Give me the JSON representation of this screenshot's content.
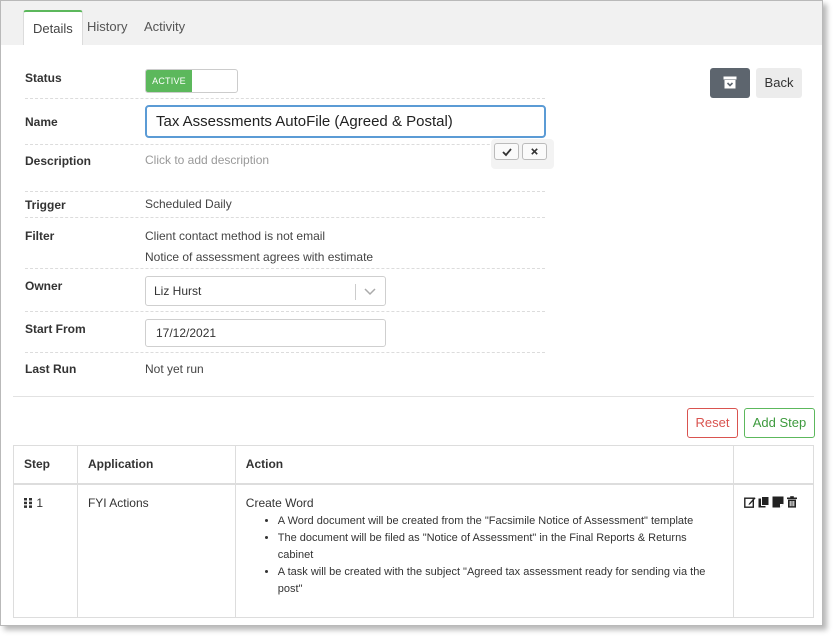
{
  "tabs": [
    {
      "label": "Details",
      "active": true
    },
    {
      "label": "History",
      "active": false
    },
    {
      "label": "Activity",
      "active": false
    }
  ],
  "fields": {
    "status": {
      "label": "Status",
      "value": "ACTIVE"
    },
    "name": {
      "label": "Name",
      "value": "Tax Assessments AutoFile (Agreed & Postal)"
    },
    "description": {
      "label": "Description",
      "placeholder": "Click to add description"
    },
    "trigger": {
      "label": "Trigger",
      "value": "Scheduled Daily"
    },
    "filter": {
      "label": "Filter",
      "values": [
        "Client contact method is not email",
        "Notice of assessment agrees with estimate"
      ]
    },
    "owner": {
      "label": "Owner",
      "value": "Liz Hurst"
    },
    "start_from": {
      "label": "Start From",
      "value": "17/12/2021"
    },
    "last_run": {
      "label": "Last Run",
      "value": "Not yet run"
    }
  },
  "buttons": {
    "back": "Back",
    "reset": "Reset",
    "add_step": "Add Step"
  },
  "table": {
    "headers": {
      "step": "Step",
      "application": "Application",
      "action": "Action"
    },
    "rows": [
      {
        "step": "1",
        "application": "FYI Actions",
        "action_title": "Create Word",
        "action_details": [
          "A Word document will be created from the \"Facsimile Notice of Assessment\" template",
          "The document will be filed as \"Notice of Assessment\" in the Final Reports & Returns cabinet",
          "A task will be created with the subject \"Agreed tax assessment ready for sending via the post\""
        ]
      }
    ]
  },
  "colors": {
    "accent_green": "#5cb85c",
    "danger_red": "#d9534f",
    "focus_blue": "#5b9bd5",
    "archive_button": "#5d656e"
  },
  "icons": [
    "archive-icon",
    "check-icon",
    "close-icon",
    "chevron-down-icon",
    "drag-handle-icon",
    "edit-icon",
    "copy-icon",
    "note-icon",
    "trash-icon"
  ]
}
